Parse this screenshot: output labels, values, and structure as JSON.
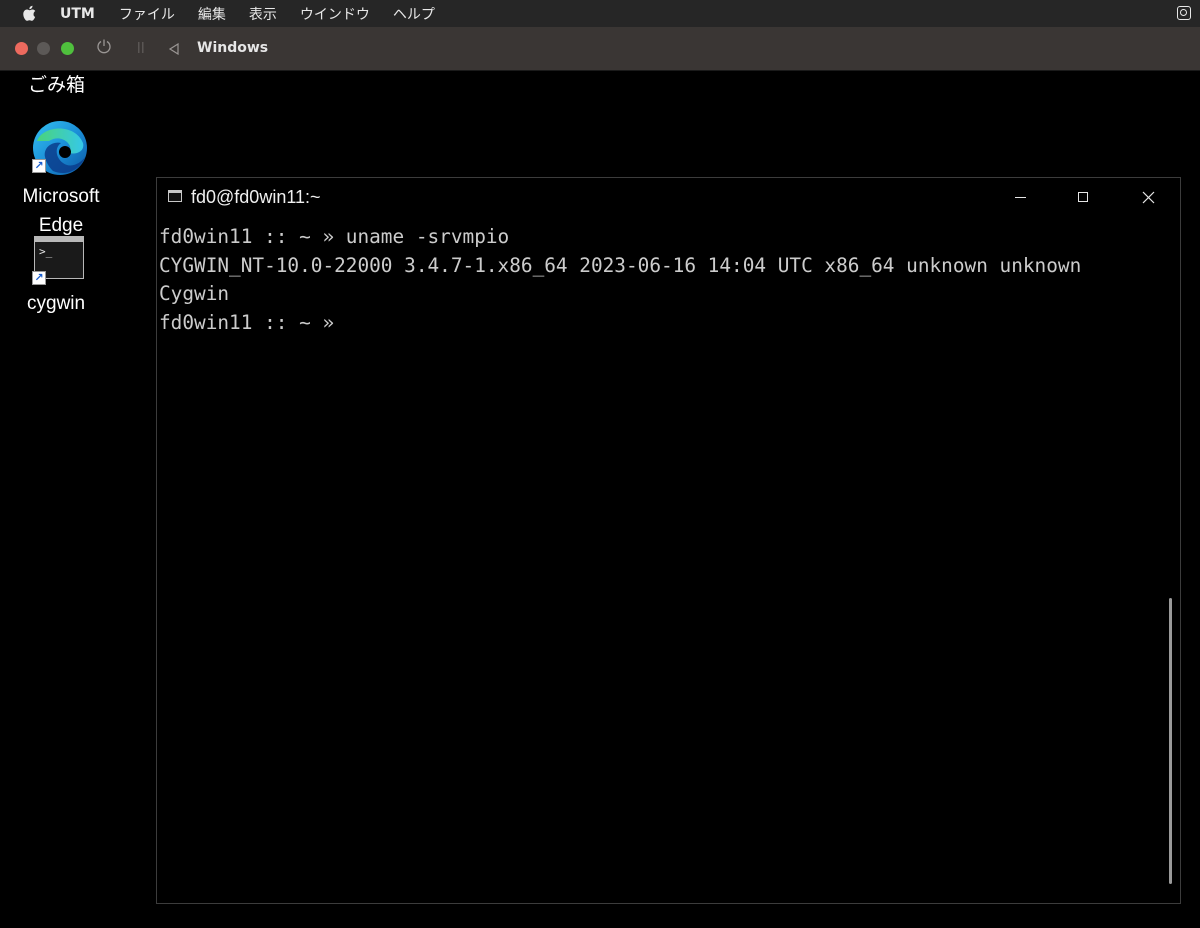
{
  "menubar": {
    "app_name": "UTM",
    "items": [
      "ファイル",
      "編集",
      "表示",
      "ウインドウ",
      "ヘルプ"
    ]
  },
  "utm_toolbar": {
    "vm_title": "Windows"
  },
  "desktop": {
    "icons": [
      {
        "label": "ごみ箱",
        "icon": "recycle-bin-icon"
      },
      {
        "label": "Microsoft Edge",
        "icon": "edge-icon"
      },
      {
        "label": "cygwin",
        "icon": "terminal-icon"
      }
    ]
  },
  "terminal": {
    "title": "fd0@fd0win11:~",
    "lines": [
      "fd0win11 :: ~ » uname -srvmpio",
      "CYGWIN_NT-10.0-22000 3.4.7-1.x86_64 2023-06-16 14:04 UTC x86_64 unknown unknown",
      "Cygwin",
      "fd0win11 :: ~ »"
    ]
  },
  "colors": {
    "close": "#ed6a5e",
    "minimize": "#5c5957",
    "maximize": "#4fc03d",
    "terminal_text": "#cccccc"
  }
}
